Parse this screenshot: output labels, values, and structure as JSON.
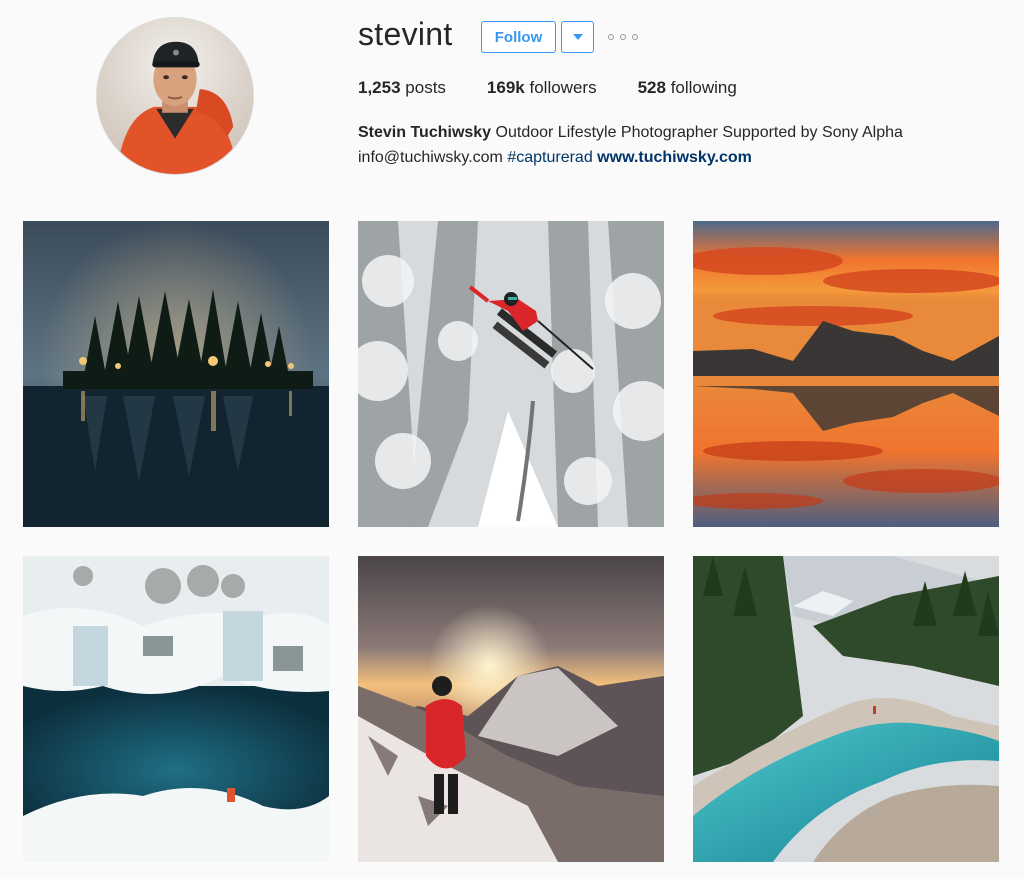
{
  "profile": {
    "username": "stevint",
    "follow_label": "Follow",
    "stats": {
      "posts_count": "1,253",
      "posts_label": "posts",
      "followers_count": "169k",
      "followers_label": "followers",
      "following_count": "528",
      "following_label": "following"
    },
    "bio": {
      "full_name": "Stevin Tuchiwsky",
      "description": "Outdoor Lifestyle Photographer Supported by Sony Alpha",
      "email": "info@tuchiwsky.com",
      "hashtag": "#capturerad",
      "website": "www.tuchiwsky.com"
    }
  },
  "icons": {
    "dropdown": "chevron-down-icon",
    "more": "more-options-icon"
  },
  "colors": {
    "accent": "#3897f0",
    "link": "#003569",
    "text": "#262626",
    "background": "#fafafa"
  },
  "grid": {
    "photos": [
      {
        "subject": "foggy-lake-forest-night"
      },
      {
        "subject": "skier-jumping-snowy-forest"
      },
      {
        "subject": "sunset-mountain-lake-reflection"
      },
      {
        "subject": "frozen-waterfall-turquoise-pool"
      },
      {
        "subject": "hiker-mountain-sunset"
      },
      {
        "subject": "turquoise-river-canyon-forest"
      }
    ]
  }
}
